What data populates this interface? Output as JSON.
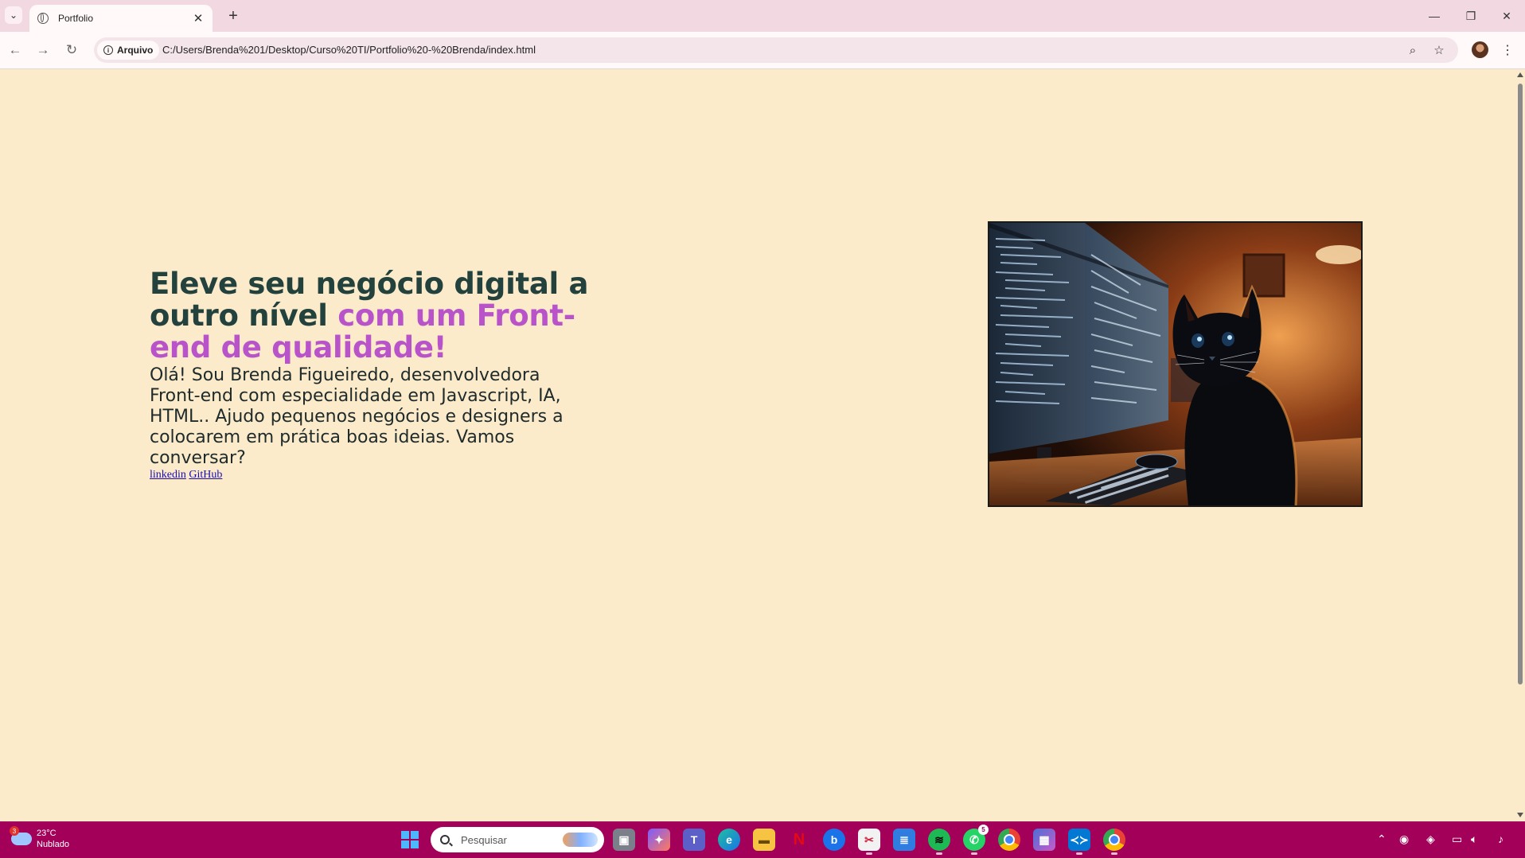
{
  "browser": {
    "tab_title": "Portfolio",
    "site_chip": "Arquivo",
    "url": "C:/Users/Brenda%201/Desktop/Curso%20TI/Portfolio%20-%20Brenda/index.html"
  },
  "hero": {
    "headline_main": "Eleve seu negócio digital a outro nível ",
    "headline_accent": "com um Front-end de qualidade!",
    "intro": "Olá! Sou Brenda Figueiredo, desenvolvedora Front-end com especialidade em Javascript, IA, HTML.. Ajudo pequenos negócios e designers a colocarem em prática boas ideias. Vamos conversar?",
    "links": [
      {
        "label": "linkedin"
      },
      {
        "label": "GitHub"
      }
    ],
    "image_icon": "black-cat-at-computer-image"
  },
  "colors": {
    "page_bg": "#fbebcb",
    "headline": "#23413d",
    "accent": "#b853c9",
    "taskbar": "#a3005a"
  },
  "taskbar": {
    "weather_temp": "23°C",
    "weather_desc": "Nublado",
    "weather_badge": "3",
    "search_placeholder": "Pesquisar",
    "whatsapp_badge": "5"
  }
}
